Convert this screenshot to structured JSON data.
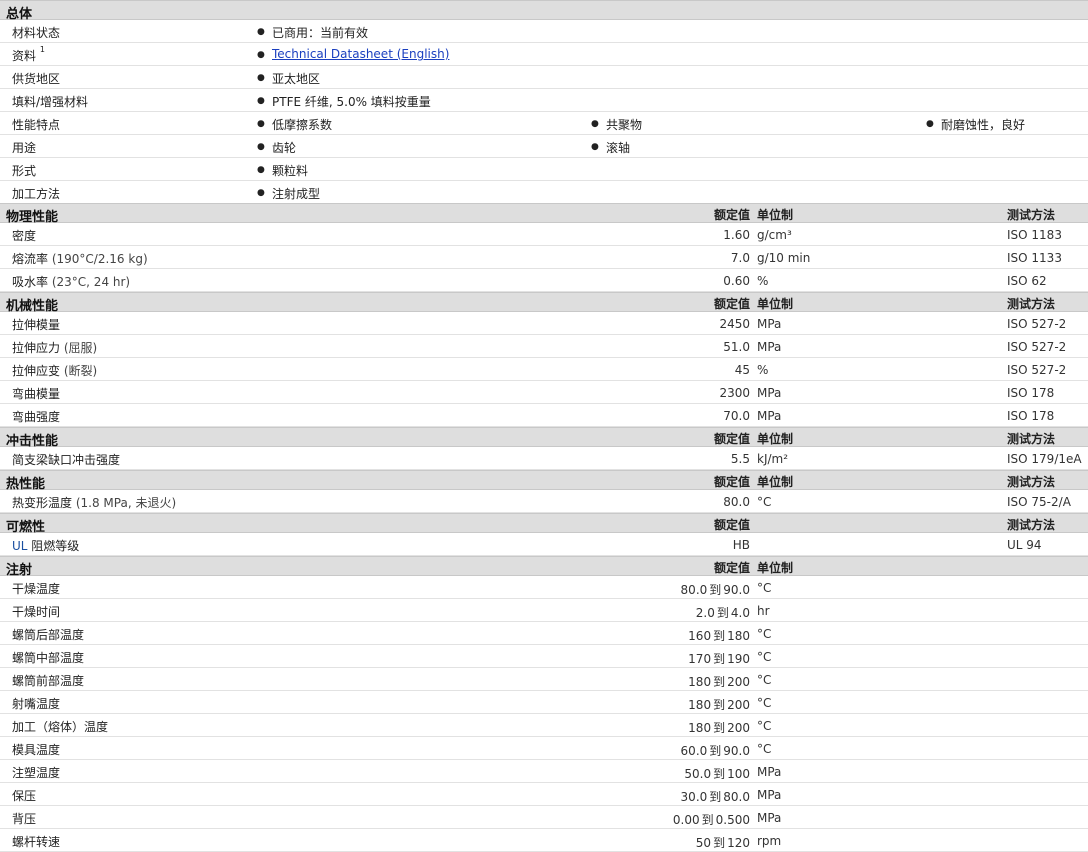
{
  "sections": {
    "overview": {
      "title": "总体"
    },
    "physical": {
      "title": "物理性能",
      "col_value": "额定值",
      "col_unit": "单位制",
      "col_method": "测试方法"
    },
    "mechanical": {
      "title": "机械性能",
      "col_value": "额定值",
      "col_unit": "单位制",
      "col_method": "测试方法"
    },
    "impact": {
      "title": "冲击性能",
      "col_value": "额定值",
      "col_unit": "单位制",
      "col_method": "测试方法"
    },
    "thermal": {
      "title": "热性能",
      "col_value": "额定值",
      "col_unit": "单位制",
      "col_method": "测试方法"
    },
    "flammability": {
      "title": "可燃性",
      "col_value": "额定值",
      "col_method": "测试方法"
    },
    "injection": {
      "title": "注射",
      "col_value": "额定值",
      "col_unit": "单位制"
    }
  },
  "overview": {
    "status_label": "材料状态",
    "status_value": "已商用：当前有效",
    "docs_label": "资料",
    "docs_sup": "1",
    "docs_link": "Technical Datasheet (English)",
    "region_label": "供货地区",
    "region_value": "亚太地区",
    "filler_label": "填料/增强材料",
    "filler_value": "PTFE 纤维, 5.0% 填料按重量",
    "features_label": "性能特点",
    "features": [
      "低摩擦系数",
      "共聚物",
      "耐磨蚀性，良好"
    ],
    "uses_label": "用途",
    "uses": [
      "齿轮",
      "滚轴"
    ],
    "form_label": "形式",
    "form_value": "颗粒料",
    "process_label": "加工方法",
    "process_value": "注射成型"
  },
  "physical": [
    {
      "label": "密度",
      "value": "1.60",
      "unit": "g/cm³",
      "method": "ISO 1183"
    },
    {
      "label": "熔流率",
      "note": "(190°C/2.16 kg)",
      "value": "7.0",
      "unit": "g/10 min",
      "method": "ISO 1133"
    },
    {
      "label": "吸水率",
      "note": "(23°C, 24 hr)",
      "value": "0.60",
      "unit": "%",
      "method": "ISO 62"
    }
  ],
  "mechanical": [
    {
      "label": "拉伸模量",
      "value": "2450",
      "unit": "MPa",
      "method": "ISO 527-2"
    },
    {
      "label": "拉伸应力",
      "note": "(屈服)",
      "value": "51.0",
      "unit": "MPa",
      "method": "ISO 527-2"
    },
    {
      "label": "拉伸应变",
      "note": "(断裂)",
      "value": "45",
      "unit": "%",
      "method": "ISO 527-2"
    },
    {
      "label": "弯曲模量",
      "value": "2300",
      "unit": "MPa",
      "method": "ISO 178"
    },
    {
      "label": "弯曲强度",
      "value": "70.0",
      "unit": "MPa",
      "method": "ISO 178"
    }
  ],
  "impact": [
    {
      "label": "简支梁缺口冲击强度",
      "value": "5.5",
      "unit": "kJ/m²",
      "method": "ISO 179/1eA"
    }
  ],
  "thermal": [
    {
      "label": "热变形温度",
      "note": "(1.8 MPa, 未退火)",
      "value": "80.0",
      "unit": "°C",
      "method": "ISO 75-2/A"
    }
  ],
  "flammability": [
    {
      "label_prefix": "UL",
      "label": "阻燃等级",
      "value": "HB",
      "method": "UL 94"
    }
  ],
  "injection": {
    "to": "到",
    "rows": [
      {
        "label": "干燥温度",
        "min": "80.0",
        "max": "90.0",
        "unit": "°C"
      },
      {
        "label": "干燥时间",
        "min": "2.0",
        "max": "4.0",
        "unit": "hr"
      },
      {
        "label": "螺筒后部温度",
        "min": "160",
        "max": "180",
        "unit": "°C"
      },
      {
        "label": "螺筒中部温度",
        "min": "170",
        "max": "190",
        "unit": "°C"
      },
      {
        "label": "螺筒前部温度",
        "min": "180",
        "max": "200",
        "unit": "°C"
      },
      {
        "label": "射嘴温度",
        "min": "180",
        "max": "200",
        "unit": "°C"
      },
      {
        "label": "加工（熔体）温度",
        "min": "180",
        "max": "200",
        "unit": "°C"
      },
      {
        "label": "模具温度",
        "min": "60.0",
        "max": "90.0",
        "unit": "°C"
      },
      {
        "label": "注塑温度",
        "min": "50.0",
        "max": "100",
        "unit": "MPa"
      },
      {
        "label": "保压",
        "min": "30.0",
        "max": "80.0",
        "unit": "MPa"
      },
      {
        "label": "背压",
        "min": "0.00",
        "max": "0.500",
        "unit": "MPa"
      },
      {
        "label": "螺杆转速",
        "min": "50",
        "max": "120",
        "unit": "rpm"
      }
    ]
  }
}
